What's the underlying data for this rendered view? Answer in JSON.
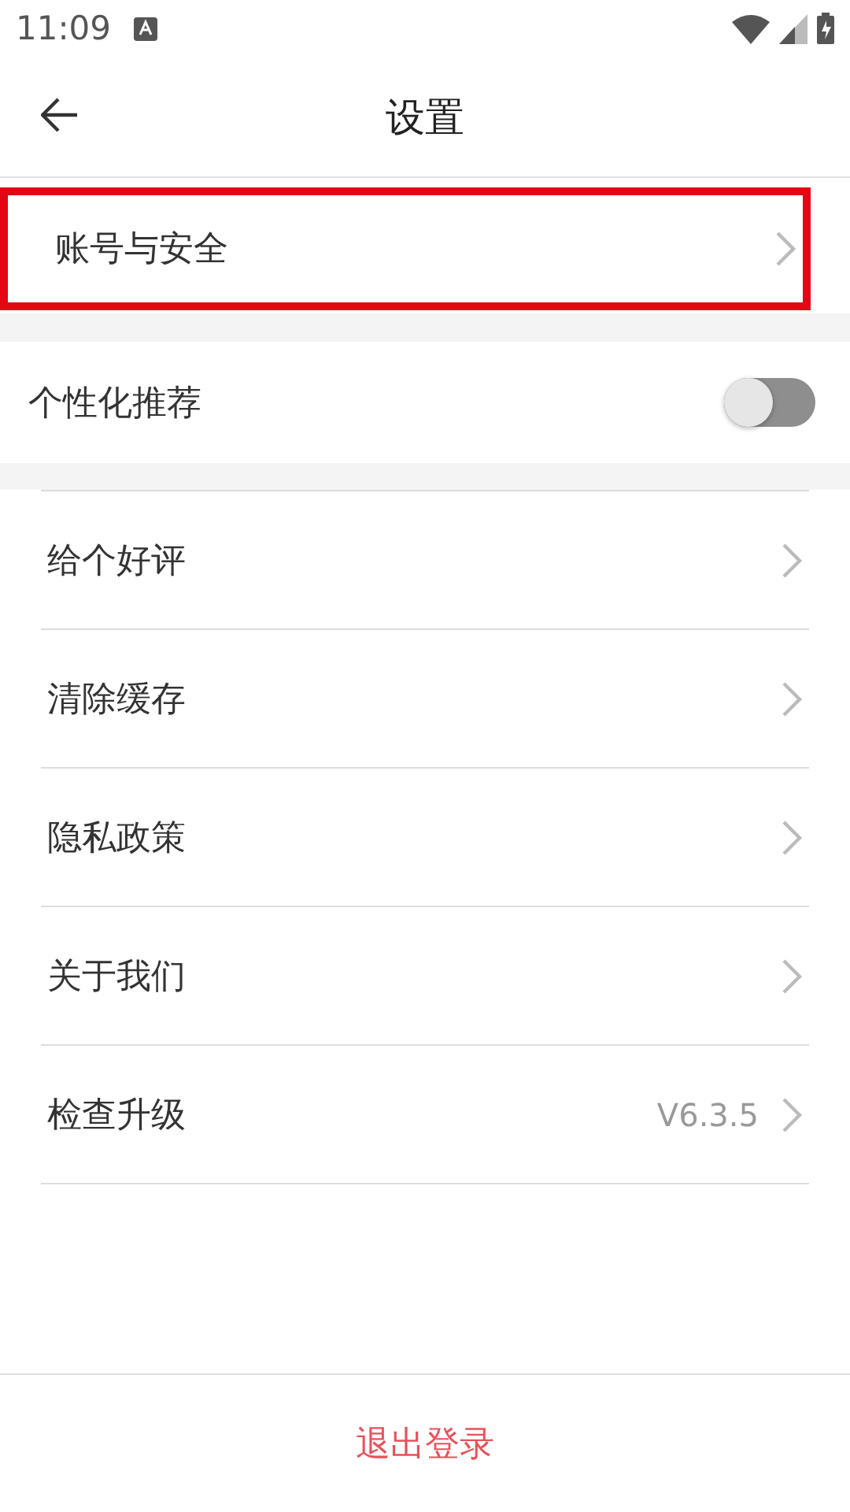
{
  "status_bar": {
    "time": "11:09"
  },
  "header": {
    "title": "设置"
  },
  "account_item": {
    "label": "账号与安全",
    "highlighted": true
  },
  "toggle_item": {
    "label": "个性化推荐",
    "on": false
  },
  "menu_items": [
    {
      "label": "给个好评"
    },
    {
      "label": "清除缓存"
    },
    {
      "label": "隐私政策"
    },
    {
      "label": "关于我们"
    },
    {
      "label": "检查升级",
      "value": "V6.3.5"
    }
  ],
  "logout_button": {
    "label": "退出登录"
  }
}
